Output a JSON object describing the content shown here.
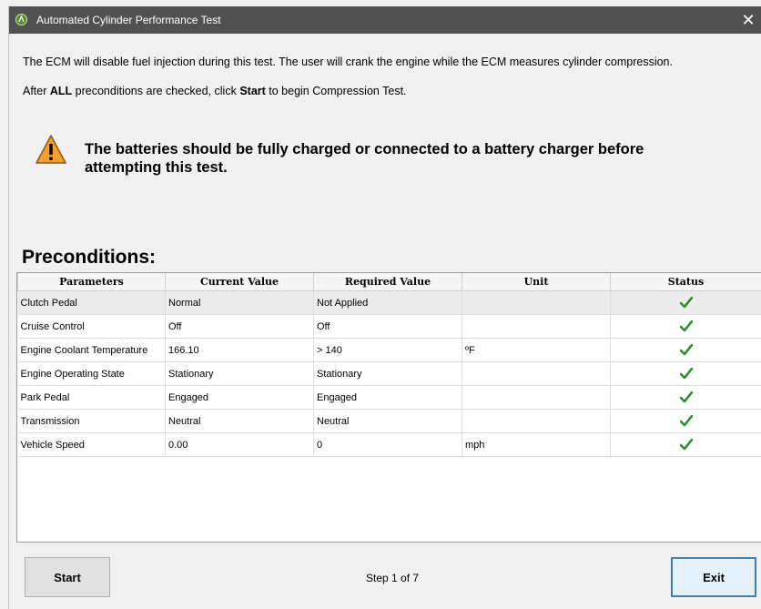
{
  "window": {
    "title": "Automated Cylinder Performance Test",
    "close_glyph": "✕"
  },
  "intro": {
    "line1": "The ECM will disable fuel injection during this test. The user will crank the engine while the ECM measures cylinder compression.",
    "line2_prefix": "After ",
    "line2_bold1": "ALL",
    "line2_mid": " preconditions are checked, click ",
    "line2_bold2": "Start",
    "line2_suffix": " to begin Compression Test."
  },
  "warning": {
    "icon": "warning-triangle-icon",
    "text": "The batteries should be fully charged or connected to a battery charger before attempting this test."
  },
  "preconditions": {
    "title": "Preconditions:",
    "columns": [
      "Parameters",
      "Current Value",
      "Required Value",
      "Unit",
      "Status"
    ],
    "rows": [
      {
        "parameter": "Clutch Pedal",
        "current": "Normal",
        "required": "Not Applied",
        "unit": "",
        "status": "pass"
      },
      {
        "parameter": "Cruise Control",
        "current": "Off",
        "required": "Off",
        "unit": "",
        "status": "pass"
      },
      {
        "parameter": "Engine Coolant Temperature",
        "current": "166.10",
        "required": "> 140",
        "unit": "ºF",
        "status": "pass"
      },
      {
        "parameter": "Engine Operating State",
        "current": "Stationary",
        "required": "Stationary",
        "unit": "",
        "status": "pass"
      },
      {
        "parameter": "Park Pedal",
        "current": "Engaged",
        "required": "Engaged",
        "unit": "",
        "status": "pass"
      },
      {
        "parameter": "Transmission",
        "current": "Neutral",
        "required": "Neutral",
        "unit": "",
        "status": "pass"
      },
      {
        "parameter": "Vehicle Speed",
        "current": "0.00",
        "required": "0",
        "unit": "mph",
        "status": "pass"
      }
    ]
  },
  "footer": {
    "start_label": "Start",
    "step_text": "Step 1 of 7",
    "exit_label": "Exit"
  },
  "colors": {
    "titlebar": "#515151",
    "check_green": "#2e8b2e",
    "warning_orange": "#f0a030"
  }
}
